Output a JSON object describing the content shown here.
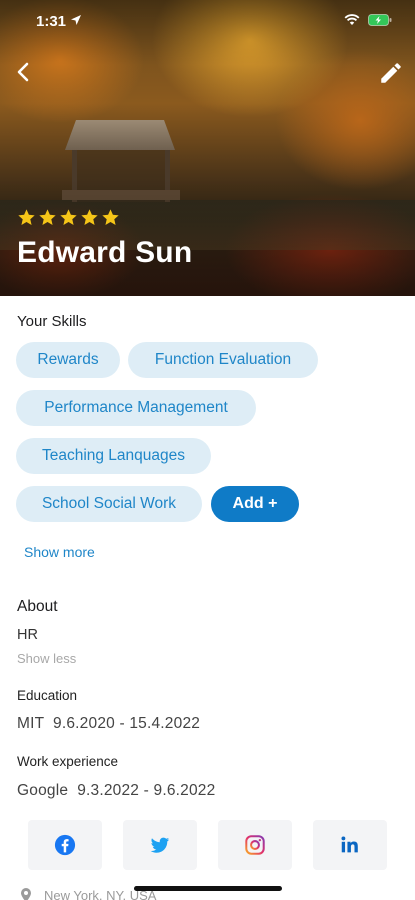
{
  "status_bar": {
    "time": "1:31"
  },
  "profile": {
    "name": "Edward Sun",
    "rating": 5,
    "rating_max": 5
  },
  "skills": {
    "title": "Your Skills",
    "items": [
      "Rewards",
      "Function Evaluation",
      "Performance Management",
      "Teaching Lanquages",
      "School Social Work"
    ],
    "add_label": "Add +",
    "show_more": "Show more"
  },
  "about": {
    "title": "About",
    "value": "HR",
    "show_less": "Show less",
    "education_title": "Education",
    "education_value": "MIT  9.6.2020 - 15.4.2022",
    "work_title": "Work experience",
    "work_value": "Google  9.3.2022 - 9.6.2022"
  },
  "socials": [
    {
      "icon": "facebook-icon",
      "color": "#1877f2"
    },
    {
      "icon": "twitter-icon",
      "color": "#1da1f2"
    },
    {
      "icon": "instagram-icon",
      "color": "#c13584"
    },
    {
      "icon": "linkedin-icon",
      "color": "#0a66c2"
    }
  ],
  "location": {
    "text": "New York, NY, USA"
  },
  "colors": {
    "accent": "#0f7bc7",
    "chip_bg": "#deedf6",
    "chip_text": "#1f86c8",
    "star": "#f5c518"
  }
}
